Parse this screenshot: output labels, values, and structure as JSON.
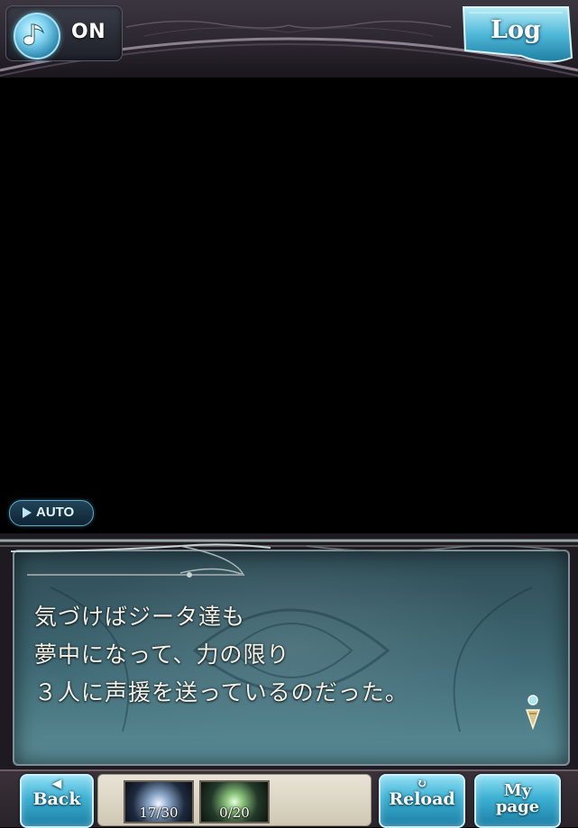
{
  "header": {
    "music_status": "ON",
    "log_label": "Log"
  },
  "scene": {
    "auto_label": "AUTO"
  },
  "dialogue": {
    "lines": [
      "気づけばジータ達も",
      "夢中になって、力の限り",
      "３人に声援を送っているのだった。"
    ]
  },
  "bottom_bar": {
    "back_label": "Back",
    "ap_value": "17/30",
    "bp_value": "0/20",
    "reload_label": "Reload",
    "mypage_line1": "My",
    "mypage_line2": "page"
  },
  "colors": {
    "accent_cyan": "#3cb0d2",
    "text_cream": "#f4f1e6",
    "frame_dark": "#2a2329"
  },
  "icons": [
    "music-note-icon",
    "play-arrow-icon",
    "back-arrow-icon",
    "reload-icon",
    "advance-cursor-icon"
  ]
}
